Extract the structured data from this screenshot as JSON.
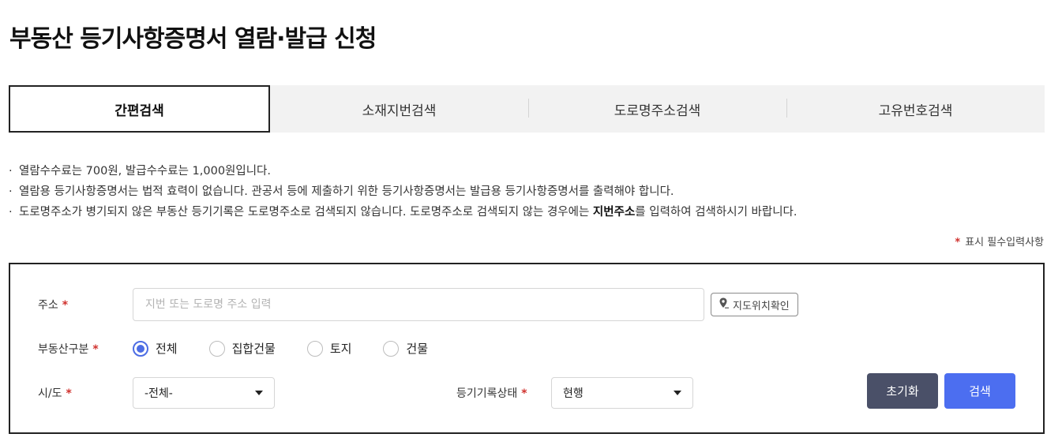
{
  "page": {
    "title": "부동산 등기사항증명서 열람·발급 신청"
  },
  "tabs": [
    {
      "label": "간편검색",
      "active": true
    },
    {
      "label": "소재지번검색",
      "active": false
    },
    {
      "label": "도로명주소검색",
      "active": false
    },
    {
      "label": "고유번호검색",
      "active": false
    }
  ],
  "notices": {
    "bullet": "·",
    "fee": "열람수수료는  700원, 발급수수료는  1,000원입니다.",
    "legal": "열람용 등기사항증명서는 법적 효력이 없습니다. 관공서 등에 제출하기 위한 등기사항증명서는 발급용 등기사항증명서를 출력해야 합니다.",
    "road_pre": "도로명주소가 병기되지 않은 부동산 등기기록은 도로명주소로 검색되지 않습니다. 도로명주소로 검색되지 않는 경우에는 ",
    "road_bold": "지번주소",
    "road_post": "를 입력하여 검색하시기 바랍니다."
  },
  "required_note": {
    "star": "*",
    "text": "표시 필수입력사항"
  },
  "form": {
    "required_star": "*",
    "address": {
      "label": "주소",
      "value": "",
      "placeholder": "지번 또는 도로명 주소 입력"
    },
    "map_button": {
      "label": "지도위치확인",
      "icon": "map-pin-icon"
    },
    "property_type": {
      "label": "부동산구분",
      "options": [
        "전체",
        "집합건물",
        "토지",
        "건물"
      ],
      "selected": "전체"
    },
    "sido": {
      "label": "시/도",
      "selected": "-전체-"
    },
    "record_status": {
      "label": "등기기록상태",
      "selected": "현행"
    }
  },
  "buttons": {
    "reset": "초기화",
    "search": "검색"
  },
  "colors": {
    "accent": "#4c6ef0",
    "reset_button": "#4a5068",
    "required": "#d0312d",
    "tab_bg": "#f2f2f2"
  }
}
